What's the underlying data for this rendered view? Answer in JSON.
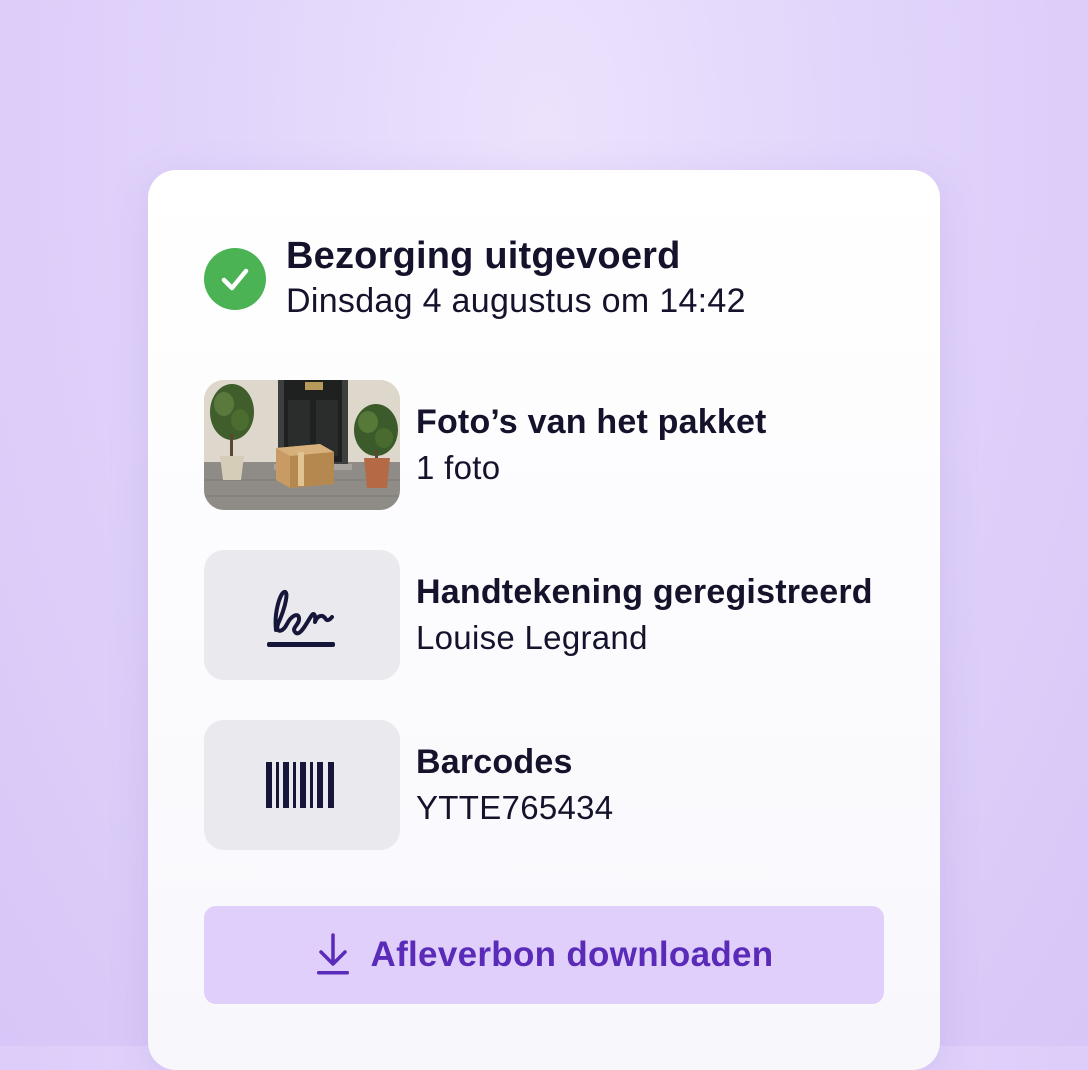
{
  "status": {
    "title": "Bezorging uitgevoerd",
    "subtitle": "Dinsdag 4 augustus om 14:42",
    "icon": "check-circle-icon",
    "color": "#4cb355"
  },
  "items": [
    {
      "title": "Foto’s van het pakket",
      "subtitle": "1 foto",
      "icon": "package-photo"
    },
    {
      "title": "Handtekening geregistreerd",
      "subtitle": "Louise Legrand",
      "icon": "signature-icon"
    },
    {
      "title": "Barcodes",
      "subtitle": "YTTE765434",
      "icon": "barcode-icon"
    }
  ],
  "download": {
    "label": "Afleverbon downloaden",
    "icon": "download-icon",
    "color": "#5a2bb8"
  }
}
